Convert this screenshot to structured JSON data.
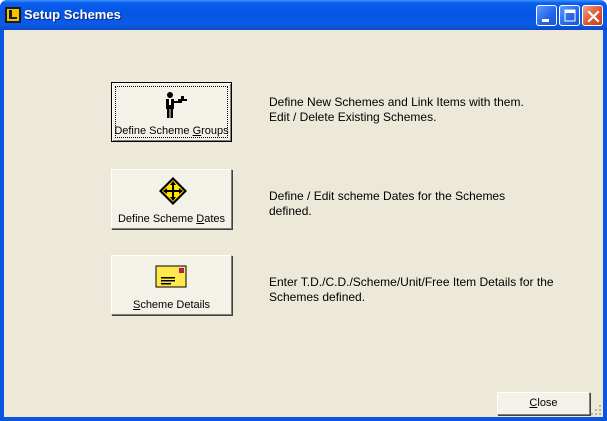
{
  "window": {
    "title": "Setup Schemes",
    "app_icon": "ledger-app-icon",
    "controls": {
      "minimize": "minimize-icon",
      "maximize": "maximize-icon",
      "close": "close-icon"
    }
  },
  "options": [
    {
      "button_prefix": "Define Scheme ",
      "button_mnemonic": "G",
      "button_suffix": "roups",
      "icon": "waiter-tray-icon",
      "description_line1": "Define New Schemes and Link Items with them.",
      "description_line2": "Edit / Delete Existing Schemes."
    },
    {
      "button_prefix": "Define Scheme ",
      "button_mnemonic": "D",
      "button_suffix": "ates",
      "icon": "diamond-arrows-icon",
      "description_line1": "Define / Edit scheme Dates for the Schemes",
      "description_line2": "defined."
    },
    {
      "button_prefix": "",
      "button_mnemonic": "S",
      "button_suffix": "cheme Details",
      "icon": "envelope-icon",
      "description_line1": "Enter T.D./C.D./Scheme/Unit/Free Item Details for the",
      "description_line2": "Schemes defined."
    }
  ],
  "footer": {
    "close_mnemonic": "C",
    "close_suffix": "lose"
  },
  "colors": {
    "titlebar": "#0554e3",
    "client_bg": "#ece9d8",
    "close_button": "#e0552e"
  }
}
